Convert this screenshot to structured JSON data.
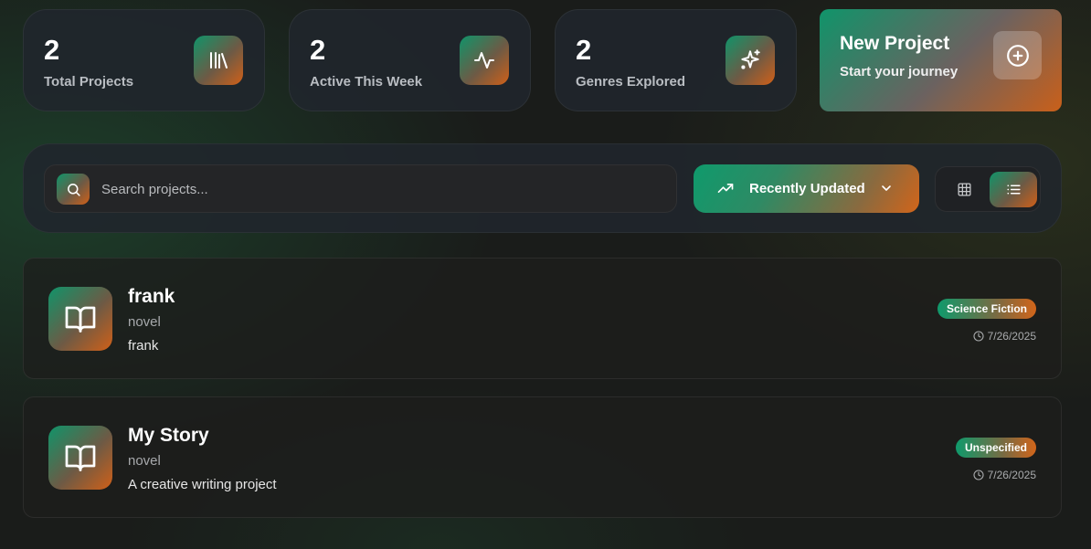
{
  "stats": [
    {
      "value": "2",
      "label": "Total Projects",
      "icon": "library-icon"
    },
    {
      "value": "2",
      "label": "Active This Week",
      "icon": "activity-icon"
    },
    {
      "value": "2",
      "label": "Genres Explored",
      "icon": "sparkles-icon"
    }
  ],
  "new_project": {
    "title": "New Project",
    "subtitle": "Start your journey",
    "icon": "plus-circle-icon"
  },
  "toolbar": {
    "search_placeholder": "Search projects...",
    "sort_label": "Recently Updated",
    "view_modes": [
      "grid",
      "list"
    ],
    "active_view": "list"
  },
  "projects": [
    {
      "title": "frank",
      "type": "novel",
      "description": "frank",
      "genre": "Science Fiction",
      "date": "7/26/2025"
    },
    {
      "title": "My Story",
      "type": "novel",
      "description": "A creative writing project",
      "genre": "Unspecified",
      "date": "7/26/2025"
    }
  ],
  "colors": {
    "accent_green": "#10946a",
    "accent_orange": "#d06018",
    "background": "#1a1c1a"
  }
}
